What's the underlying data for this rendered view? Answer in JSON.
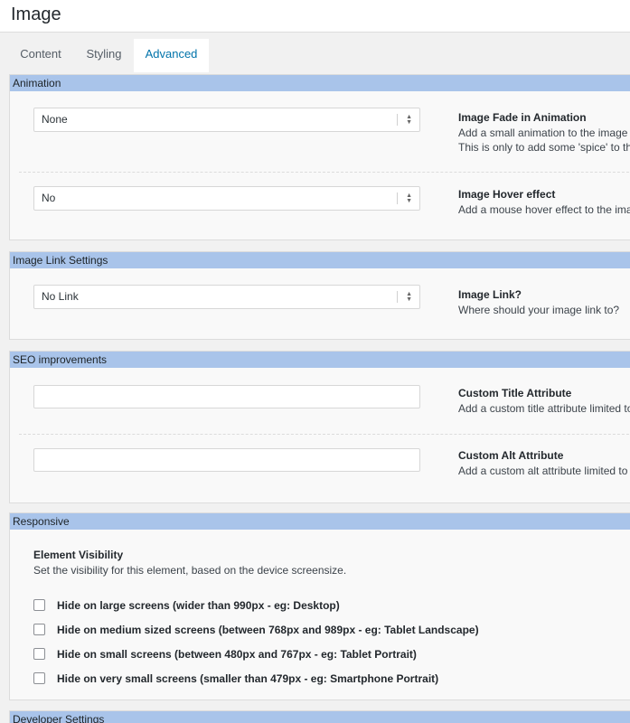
{
  "window": {
    "title": "Image"
  },
  "tabs": [
    {
      "label": "Content"
    },
    {
      "label": "Styling"
    },
    {
      "label": "Advanced",
      "active": true
    }
  ],
  "animation": {
    "header": "Animation",
    "fade": {
      "value": "None",
      "label": "Image Fade in Animation",
      "desc1": "Add a small animation to the image w",
      "desc2": "This is only to add some 'spice' to th"
    },
    "hover": {
      "value": "No",
      "label": "Image Hover effect",
      "desc1": "Add a mouse hover effect to the ima"
    }
  },
  "link": {
    "header": "Image Link Settings",
    "value": "No Link",
    "label": "Image Link?",
    "desc1": "Where should your image link to?"
  },
  "seo": {
    "header": "SEO improvements",
    "title_attr": {
      "value": "",
      "label": "Custom Title Attribute",
      "desc1": "Add a custom title attribute limited to"
    },
    "alt_attr": {
      "value": "",
      "label": "Custom Alt Attribute",
      "desc1": "Add a custom alt attribute limited to"
    }
  },
  "responsive": {
    "header": "Responsive",
    "label": "Element Visibility",
    "desc": "Set the visibility for this element, based on the device screensize.",
    "options": [
      {
        "label": "Hide on large screens (wider than 990px - eg: Desktop)",
        "checked": false
      },
      {
        "label": "Hide on medium sized screens (between 768px and 989px - eg: Tablet Landscape)",
        "checked": false
      },
      {
        "label": "Hide on small screens (between 480px and 767px - eg: Tablet Portrait)",
        "checked": false
      },
      {
        "label": "Hide on very small screens (smaller than 479px - eg: Smartphone Portrait)",
        "checked": false
      }
    ]
  },
  "developer": {
    "header": "Developer Settings"
  },
  "colors": {
    "section_header": "#a9c4ea",
    "active_tab_text": "#0073aa",
    "panel_bg": "#f1f1f1"
  }
}
